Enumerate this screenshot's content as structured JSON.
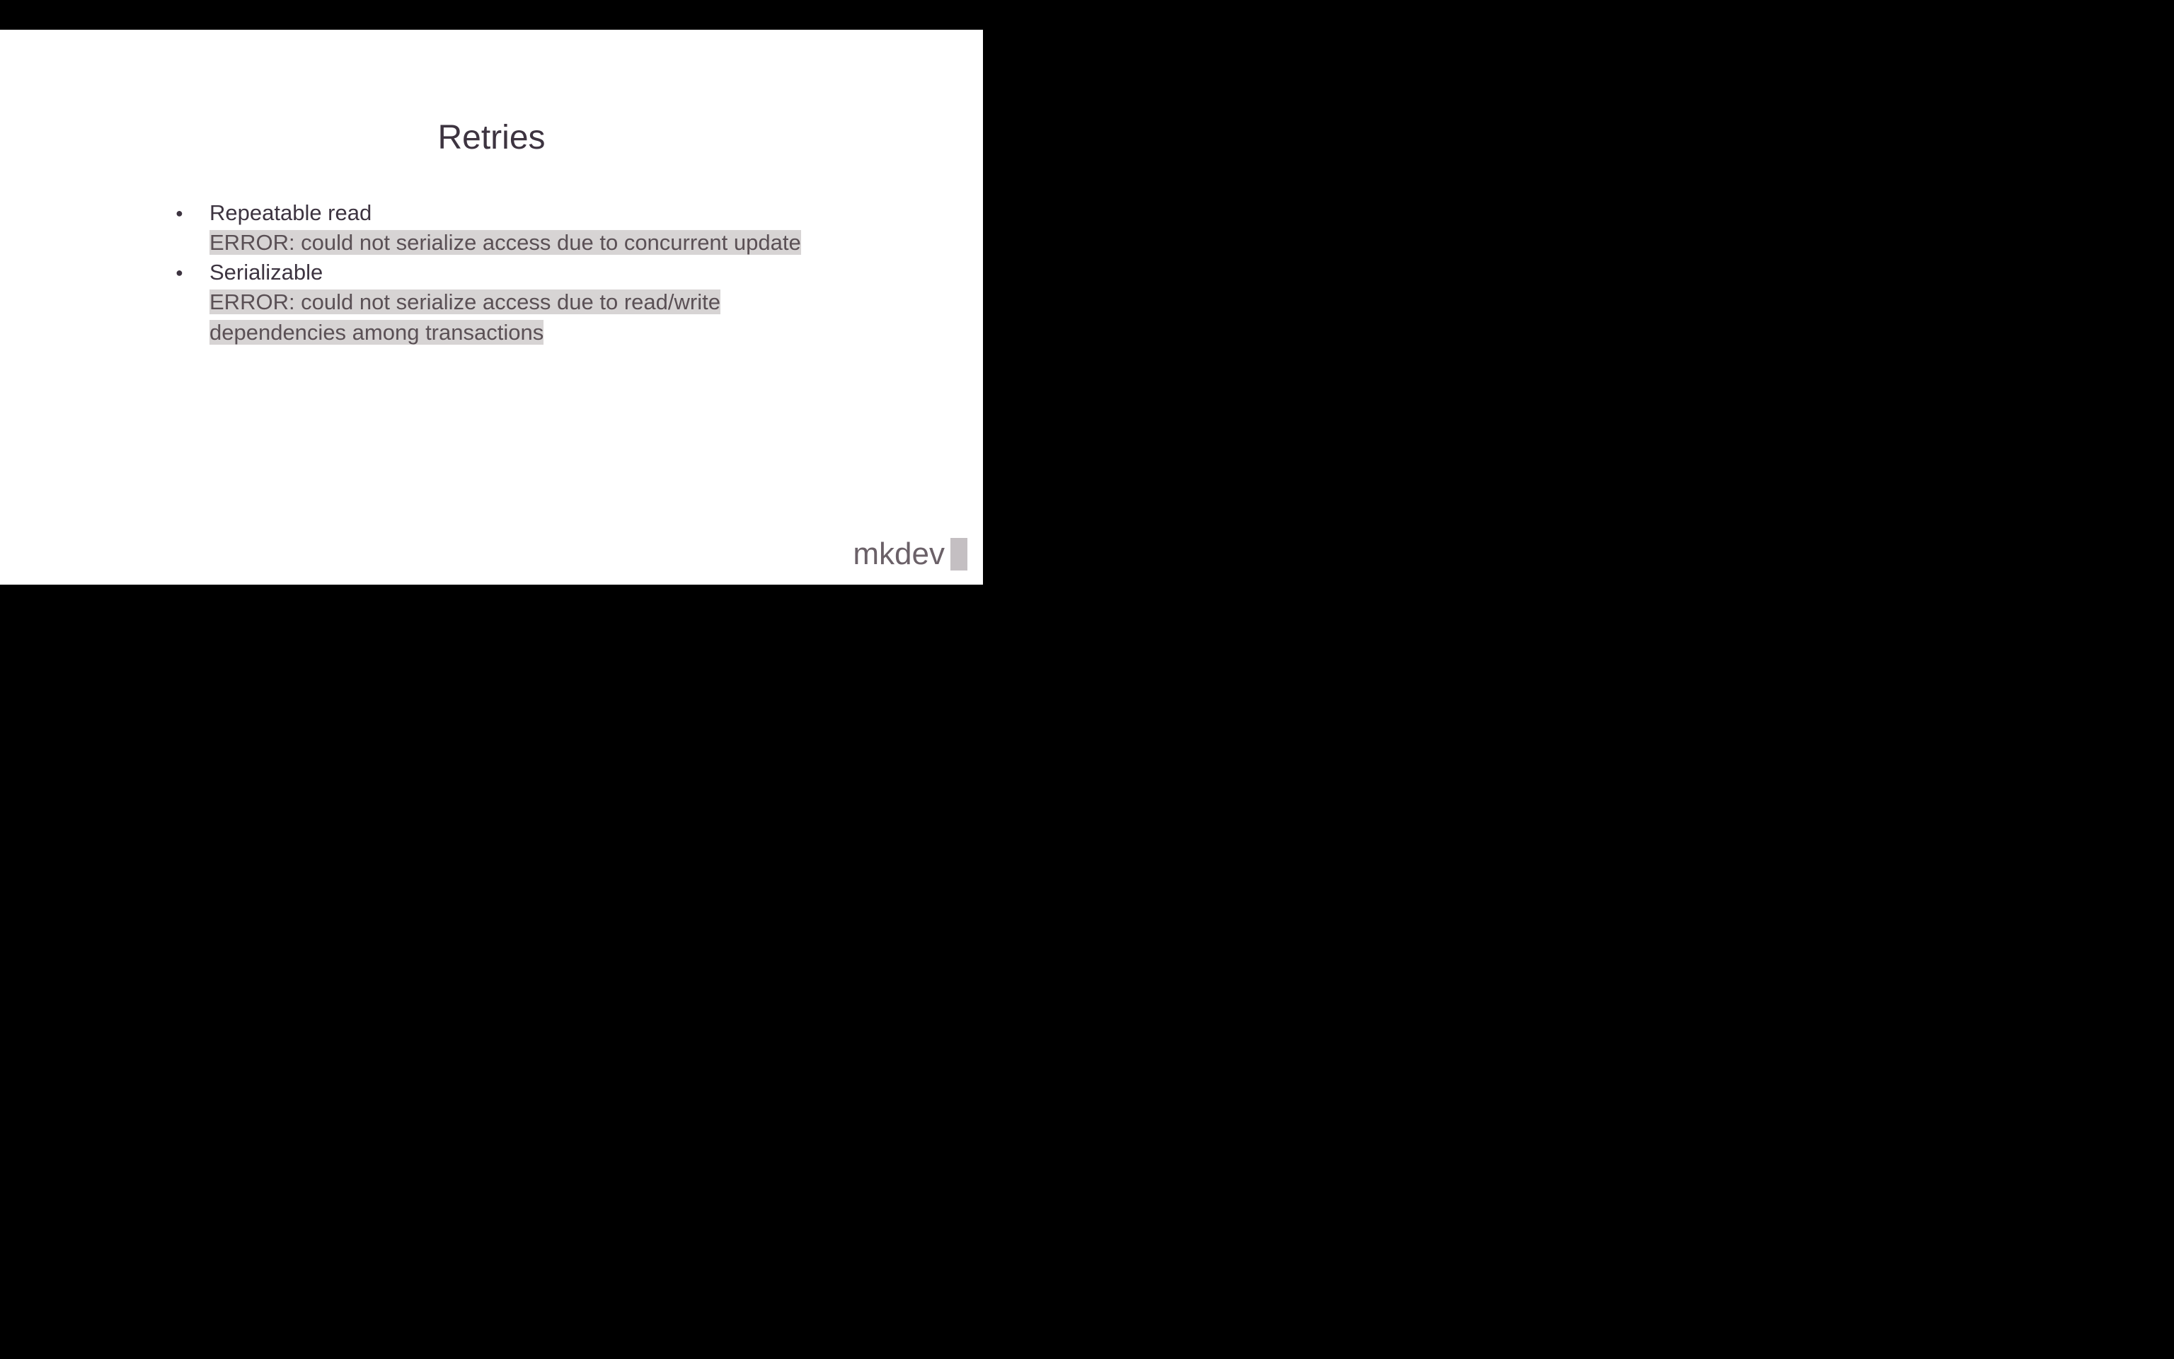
{
  "slide": {
    "title": "Retries",
    "bullets": [
      {
        "label": "Repeatable read",
        "error": "ERROR:  could not serialize access due to concurrent update"
      },
      {
        "label": "Serializable",
        "error": "ERROR:  could not serialize access due to read/write dependencies among transactions"
      }
    ]
  },
  "branding": {
    "logo_text": "mkdev"
  }
}
